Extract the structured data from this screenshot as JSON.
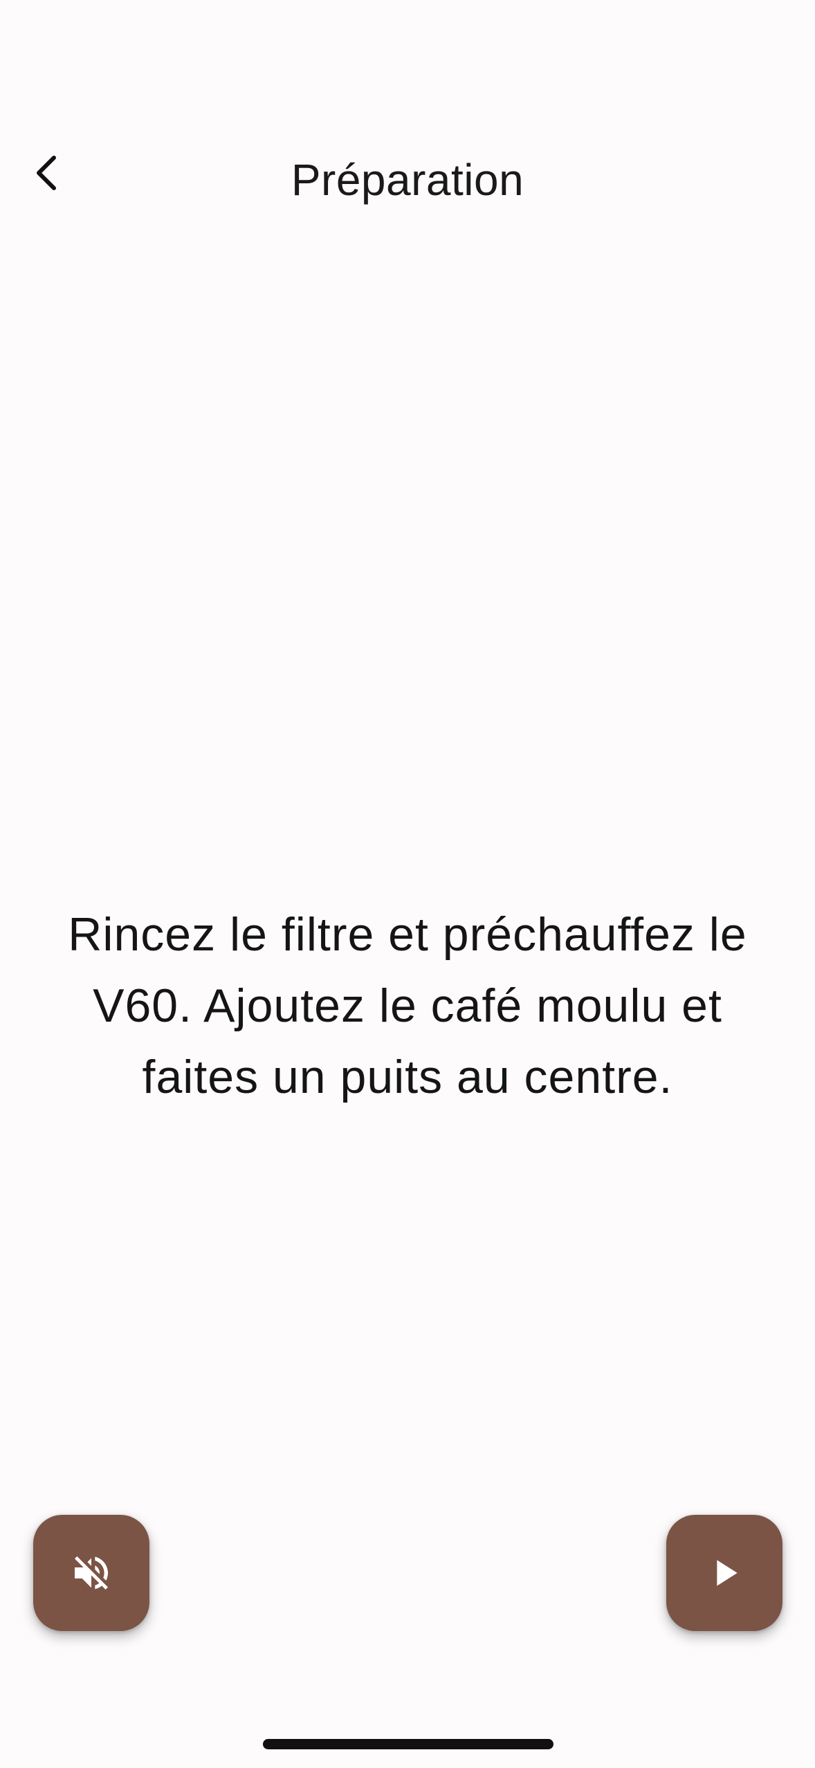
{
  "header": {
    "title": "Préparation",
    "back_icon": "chevron-left-icon"
  },
  "main": {
    "instruction": "Rincez le filtre et préchauffez le V60. Ajoutez le café moulu et faites un puits au centre."
  },
  "controls": {
    "mute_icon": "volume-off-icon",
    "play_icon": "play-icon",
    "button_color": "#7B5446",
    "icon_color": "#FFFFFF"
  },
  "colors": {
    "background": "#FDFBFB",
    "text": "#1A1A1A"
  }
}
